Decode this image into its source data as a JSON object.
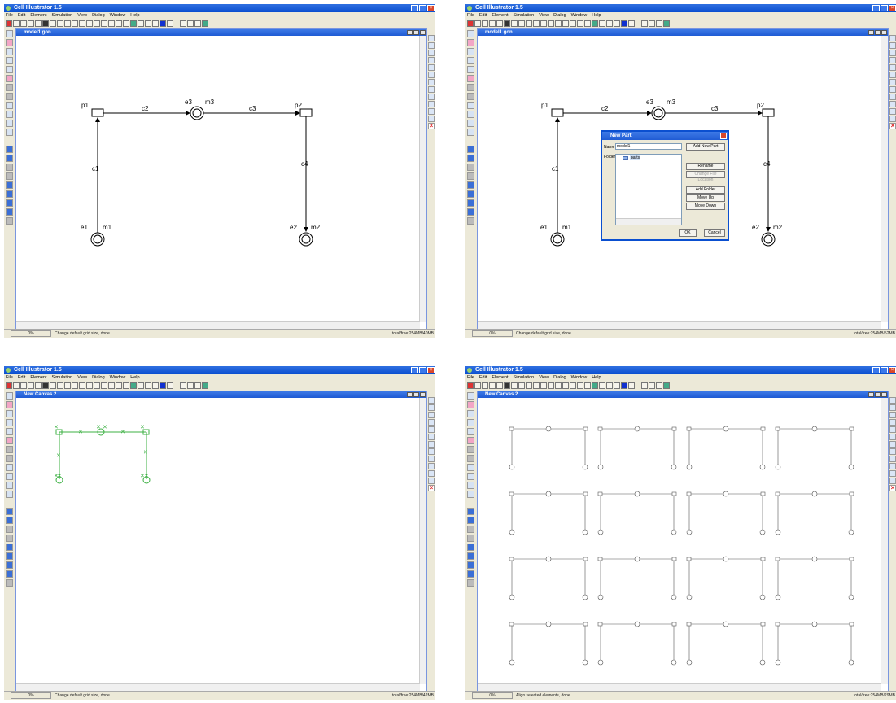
{
  "app": {
    "title": "Cell Illustrator 1.5",
    "menus": [
      "File",
      "Edit",
      "Element",
      "Simulation",
      "View",
      "Dialog",
      "Window",
      "Help"
    ]
  },
  "windows": [
    {
      "doc_title": "model1.gon",
      "progress": "0%",
      "status": "Change default grid size, done.",
      "memory": "total/free:254MB/40MB"
    },
    {
      "doc_title": "model1.gon",
      "progress": "0%",
      "status": "Change default grid size, done.",
      "memory": "total/free:254MB/52MB"
    },
    {
      "doc_title": "New Canvas 2",
      "progress": "0%",
      "status": "Change default grid size, done.",
      "memory": "total/free:254MB/42MB"
    },
    {
      "doc_title": "New Canvas 2",
      "progress": "0%",
      "status": "Align selected elements, done.",
      "memory": "total/free:254MB/29MB"
    }
  ],
  "model": {
    "labels": {
      "p1": "p1",
      "p2": "p2",
      "c1": "c1",
      "c2": "c2",
      "c3": "c3",
      "c4": "c4",
      "e1": "e1",
      "e2": "e2",
      "e3": "e3",
      "m1": "m1",
      "m2": "m2",
      "m3": "m3"
    }
  },
  "dialog": {
    "title": "New Part",
    "name_label": "Name",
    "name_value": "model1",
    "folder_label": "Folder",
    "folder_item": "parts",
    "buttons": {
      "add_new_part": "Add New Part",
      "rename": "Rename",
      "change_file_location": "Change File Location",
      "add_folder": "Add Folder",
      "move_up": "Move Up",
      "move_down": "Move Down",
      "ok": "OK",
      "cancel": "Cancel"
    }
  },
  "icons": {
    "titlebar": "app-icon",
    "minimize": "minimize-icon",
    "maximize": "maximize-icon",
    "close": "close-icon",
    "folder": "folder-icon"
  },
  "colors": {
    "titlebar": "#0a4fd0",
    "selection": "#3cb043",
    "close": "#d9472b"
  }
}
